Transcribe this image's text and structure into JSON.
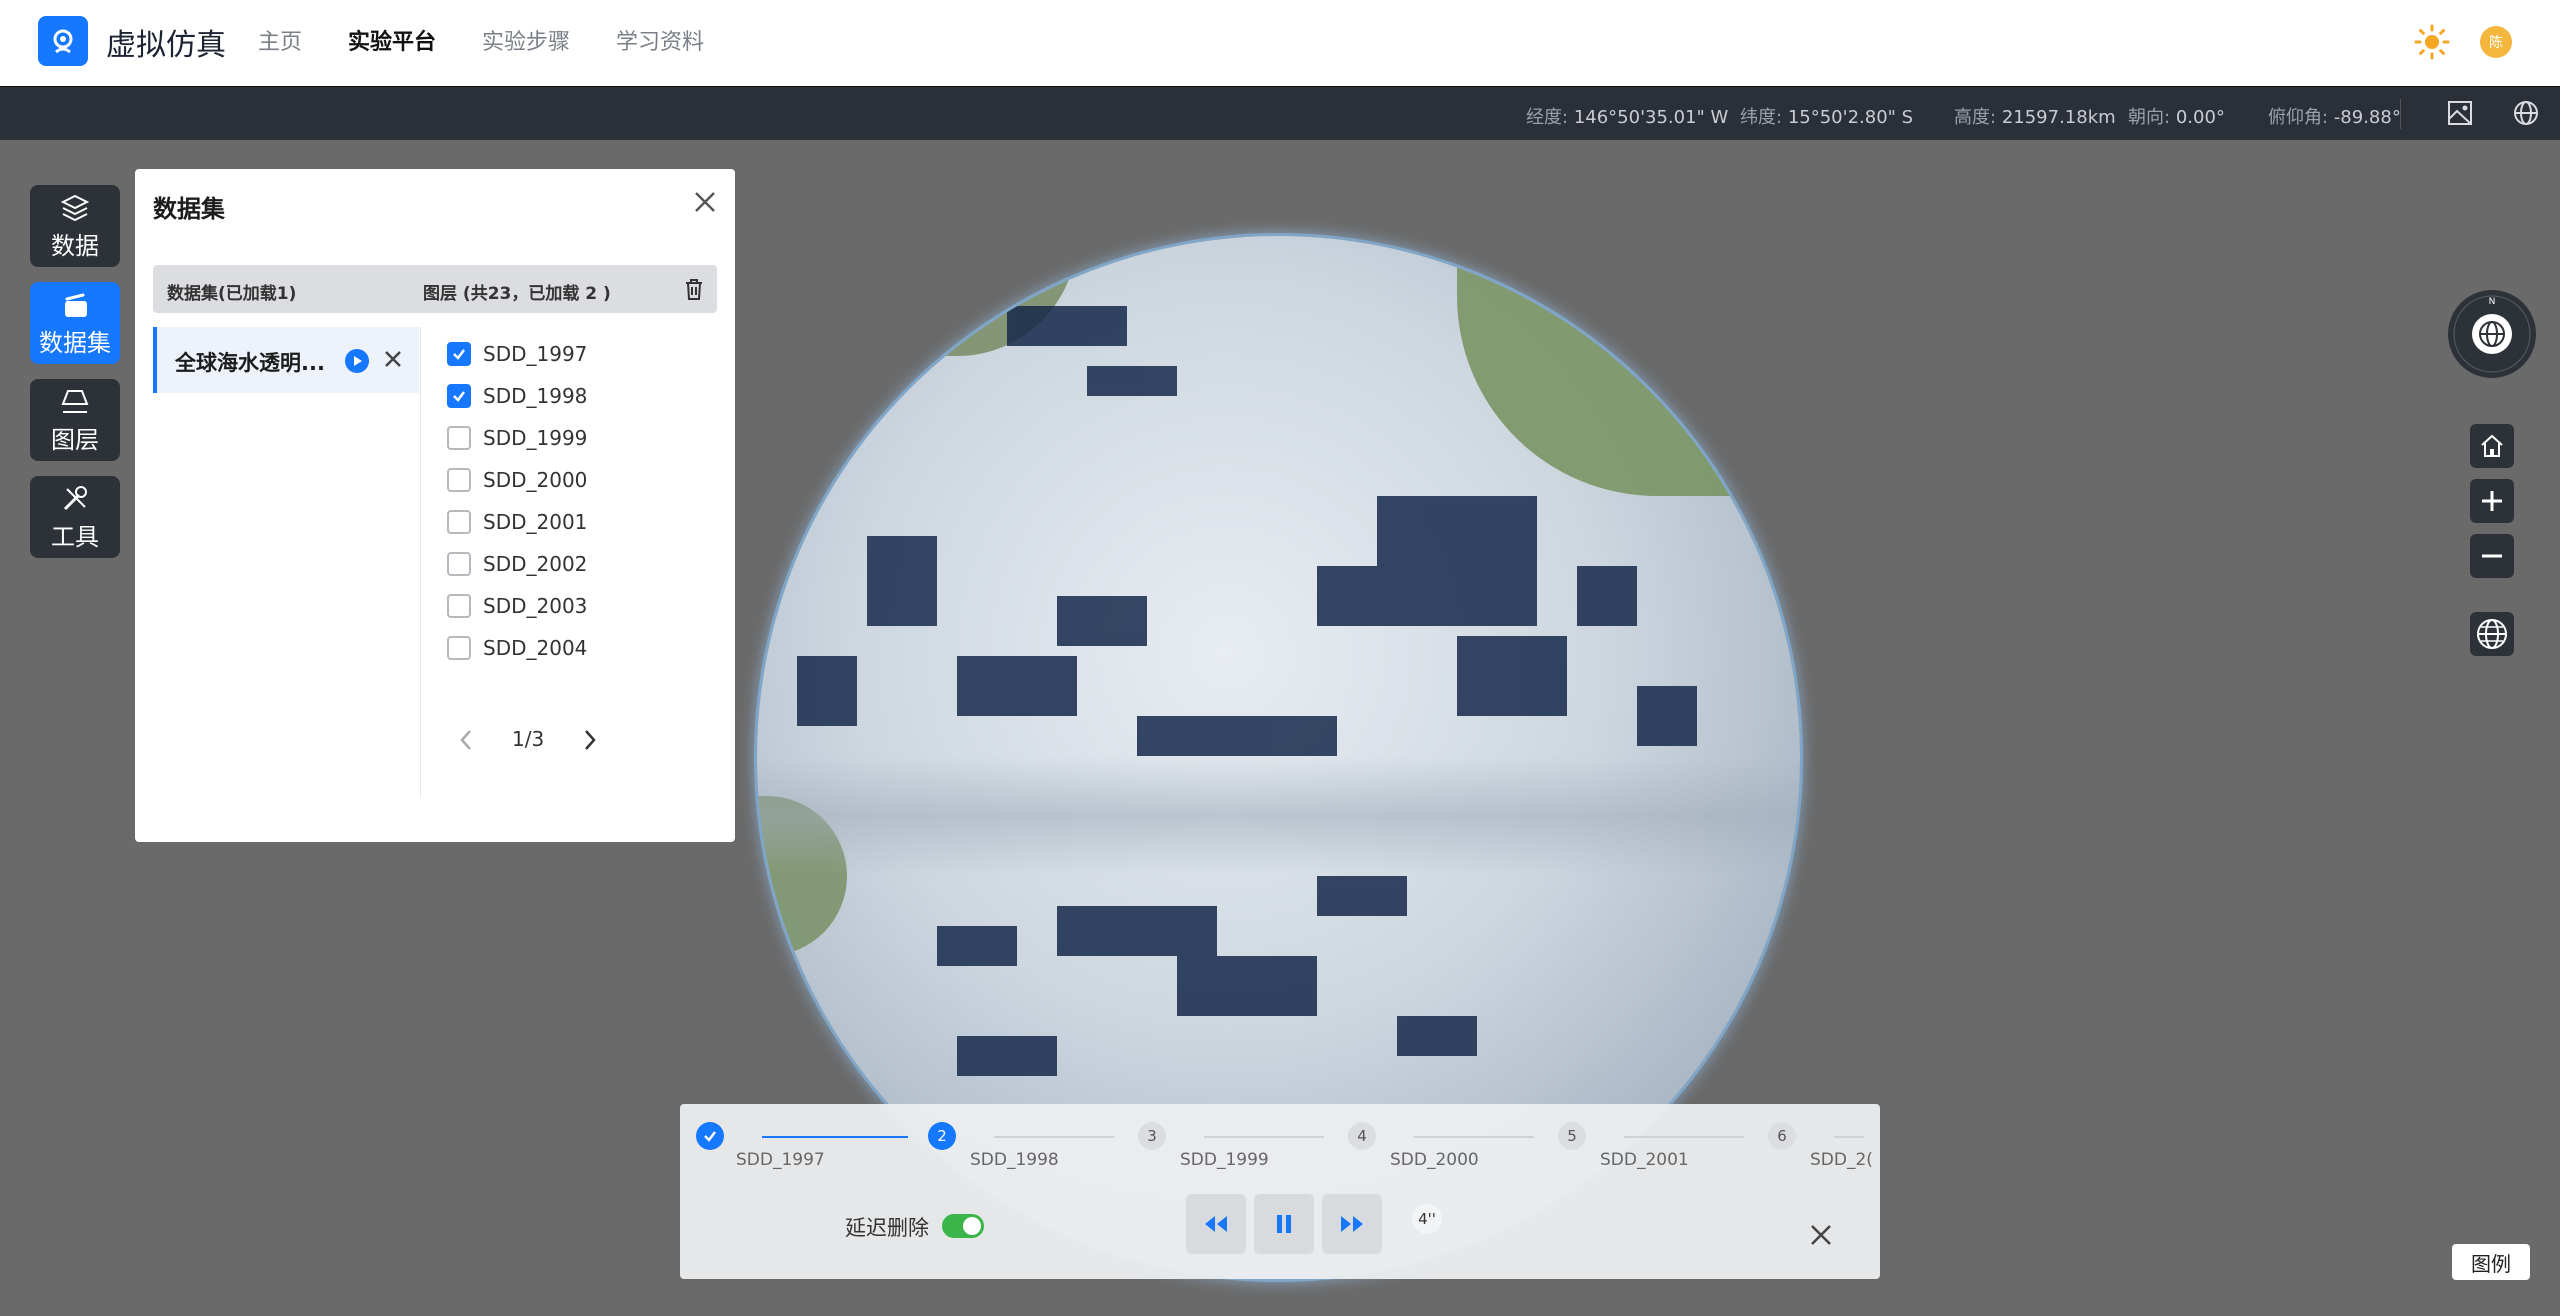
{
  "app": {
    "title": "虚拟仿真"
  },
  "nav": [
    {
      "label": "主页",
      "active": false
    },
    {
      "label": "实验平台",
      "active": true
    },
    {
      "label": "实验步骤",
      "active": false
    },
    {
      "label": "学习资料",
      "active": false
    }
  ],
  "user": {
    "avatar_text": "陈"
  },
  "status": {
    "lon_label": "经度:",
    "lon_value": "146°50'35.01\" W",
    "lat_label": "纬度:",
    "lat_value": "15°50'2.80\" S",
    "alt_label": "高度:",
    "alt_value": "21597.18km",
    "heading_label": "朝向:",
    "heading_value": "0.00°",
    "pitch_label": "俯仰角:",
    "pitch_value": "-89.88°"
  },
  "sidebar": [
    {
      "label": "数据",
      "icon": "layers-icon",
      "active": false
    },
    {
      "label": "数据集",
      "icon": "dataset-icon",
      "active": true
    },
    {
      "label": "图层",
      "icon": "layer-plane-icon",
      "active": false
    },
    {
      "label": "工具",
      "icon": "tools-icon",
      "active": false
    }
  ],
  "panel": {
    "title": "数据集",
    "header_left": "数据集(已加载1)",
    "header_right": "图层 (共23，已加载 2 )",
    "dataset_name": "全球海水透明...",
    "layers": [
      {
        "name": "SDD_1997",
        "checked": true
      },
      {
        "name": "SDD_1998",
        "checked": true
      },
      {
        "name": "SDD_1999",
        "checked": false
      },
      {
        "name": "SDD_2000",
        "checked": false
      },
      {
        "name": "SDD_2001",
        "checked": false
      },
      {
        "name": "SDD_2002",
        "checked": false
      },
      {
        "name": "SDD_2003",
        "checked": false
      },
      {
        "name": "SDD_2004",
        "checked": false
      }
    ],
    "page": "1/3"
  },
  "timeline": {
    "steps": [
      {
        "num": "",
        "label": "SDD_1997",
        "state": "done"
      },
      {
        "num": "2",
        "label": "SDD_1998",
        "state": "current"
      },
      {
        "num": "3",
        "label": "SDD_1999",
        "state": "todo"
      },
      {
        "num": "4",
        "label": "SDD_2000",
        "state": "todo"
      },
      {
        "num": "5",
        "label": "SDD_2001",
        "state": "todo"
      },
      {
        "num": "6",
        "label": "SDD_2(",
        "state": "todo"
      }
    ],
    "delay_label": "延迟删除",
    "delay_on": true,
    "speed": "4''"
  },
  "legend_label": "图例",
  "colors": {
    "accent": "#1677ff",
    "toolbar": "#2d3138",
    "toggle_on": "#3bb54a"
  }
}
